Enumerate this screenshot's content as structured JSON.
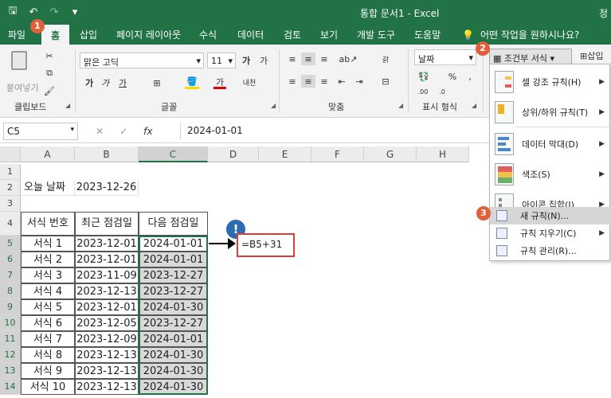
{
  "titlebar": {
    "title": "통합 문서1  -  Excel",
    "right_char": "정",
    "qat": {
      "save": "🖫",
      "undo": "↶",
      "redo": "↷",
      "more": "▾"
    }
  },
  "tabs": [
    "파일",
    "홈",
    "삽입",
    "페이지 레이아웃",
    "수식",
    "데이터",
    "검토",
    "보기",
    "개발 도구",
    "도움말"
  ],
  "active_tab": "홈",
  "tellme": "어떤 작업을 원하시나요?",
  "ribbon": {
    "clipboard_label": "클립보드",
    "paste_label": "붙여넣기",
    "font_name": "맑은 고딕",
    "font_size": "11",
    "font_label": "글꼴",
    "align_label": "맞춤",
    "number_format": "날짜",
    "number_label": "표시 형식",
    "cf_button": "조건부 서식 ▾",
    "insert_label": "삽입"
  },
  "formula_bar": {
    "name_box": "C5",
    "formula": "2024-01-01"
  },
  "columns": [
    "A",
    "B",
    "C",
    "D",
    "E",
    "F",
    "G",
    "H"
  ],
  "rows": [
    "1",
    "2",
    "3",
    "4",
    "5",
    "6",
    "7",
    "8",
    "9",
    "10",
    "11",
    "12",
    "13",
    "14"
  ],
  "cells": {
    "A2": "오늘 날짜",
    "B2": "2023-12-26",
    "A4": "서식 번호",
    "B4": "최근 점검일",
    "C4": "다음 점검일"
  },
  "table": [
    [
      "서식 1",
      "2023-12-01",
      "2024-01-01"
    ],
    [
      "서식 2",
      "2023-12-01",
      "2024-01-01"
    ],
    [
      "서식 3",
      "2023-11-09",
      "2023-12-27"
    ],
    [
      "서식 4",
      "2023-12-13",
      "2023-12-27"
    ],
    [
      "서식 5",
      "2023-12-01",
      "2024-01-30"
    ],
    [
      "서식 6",
      "2023-12-05",
      "2023-12-27"
    ],
    [
      "서식 7",
      "2023-12-09",
      "2024-01-01"
    ],
    [
      "서식 8",
      "2023-12-13",
      "2024-01-30"
    ],
    [
      "서식 9",
      "2023-12-13",
      "2024-01-30"
    ],
    [
      "서식 10",
      "2023-12-13",
      "2024-01-30"
    ]
  ],
  "annotation": {
    "formula_note": "=B5+31",
    "info": "!",
    "badges": [
      "1",
      "2",
      "3"
    ]
  },
  "menu": {
    "highlight": "셀 강조 규칙(H)",
    "topbottom": "상위/하위 규칙(T)",
    "databar": "데이터 막대(D)",
    "colorscale": "색조(S)",
    "iconset": "아이콘 집합(I)",
    "newrule": "새 규칙(N)...",
    "clearrules": "규칙 지우기(C)",
    "managerules": "규칙 관리(R)..."
  }
}
